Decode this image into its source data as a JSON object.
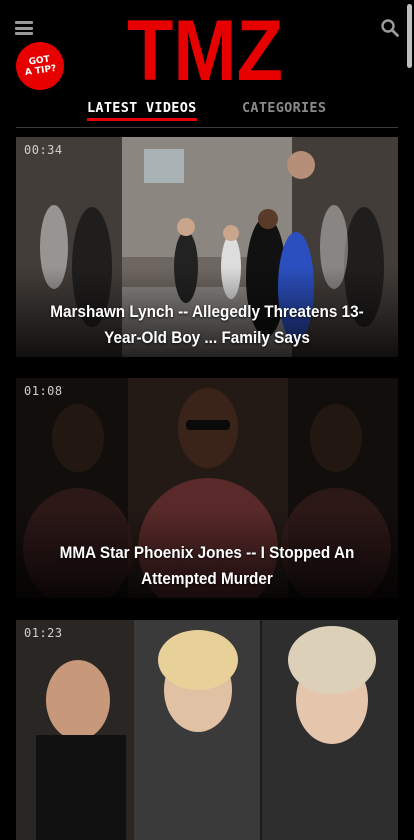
{
  "header": {
    "logo_text": "TMZ",
    "tip_badge": {
      "line1": "GOT",
      "line2": "A TIP?"
    },
    "menu_icon": "hamburger-menu-icon",
    "search_icon": "search-icon"
  },
  "tabs": [
    {
      "label": "LATEST VIDEOS",
      "active": true
    },
    {
      "label": "CATEGORIES",
      "active": false
    }
  ],
  "videos": [
    {
      "duration": "00:34",
      "title": "Marshawn Lynch -- Allegedly Threatens 13-Year-Old Boy ... Family Says"
    },
    {
      "duration": "01:08",
      "title": "MMA Star Phoenix Jones -- I Stopped An Attempted Murder"
    },
    {
      "duration": "01:23",
      "title": ""
    }
  ],
  "colors": {
    "brand_red": "#e60000",
    "background": "#000000",
    "inactive_tab": "#8a8a8a"
  }
}
